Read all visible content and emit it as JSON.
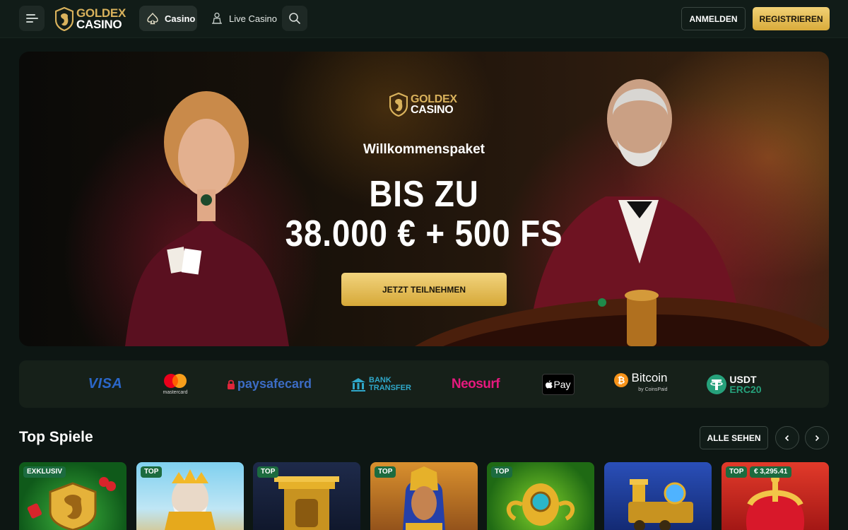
{
  "header": {
    "logo_line1": "GOLDEX",
    "logo_line2": "CASINO",
    "nav": [
      {
        "label": "Casino",
        "icon": "spade-icon",
        "active": true
      },
      {
        "label": "Live Casino",
        "icon": "dealer-icon",
        "active": false
      }
    ],
    "login_label": "ANMELDEN",
    "register_label": "REGISTRIEREN"
  },
  "hero": {
    "logo_line1": "GOLDEX",
    "logo_line2": "CASINO",
    "subtitle": "Willkommenspaket",
    "title_line1": "BIS ZU",
    "title_line2": "38.000 € + 500 FS",
    "cta_label": "JETZT TEILNEHMEN"
  },
  "payments": {
    "visa": "VISA",
    "mastercard": "mastercard",
    "paysafecard": "paysafecard",
    "bank_line1": "BANK",
    "bank_line2": "TRANSFER",
    "neosurf": "Neosurf",
    "applepay": "Pay",
    "bitcoin": "Bitcoin",
    "bitcoin_sub": "by CoinsPaid",
    "usdt_line1": "USDT",
    "usdt_line2": "ERC20"
  },
  "top_games": {
    "title": "Top Spiele",
    "see_all_label": "ALLE SEHEN",
    "cards": [
      {
        "badge": "EXKLUSIV"
      },
      {
        "badge": "TOP"
      },
      {
        "badge": "TOP"
      },
      {
        "badge": "TOP"
      },
      {
        "badge": "TOP"
      },
      {
        "badge": ""
      },
      {
        "badge": "TOP",
        "jackpot": "€ 3,295.41"
      }
    ]
  },
  "colors": {
    "background": "#0d1613",
    "gold": "#d9ab3b",
    "badge_green": "#1c6b3f"
  }
}
